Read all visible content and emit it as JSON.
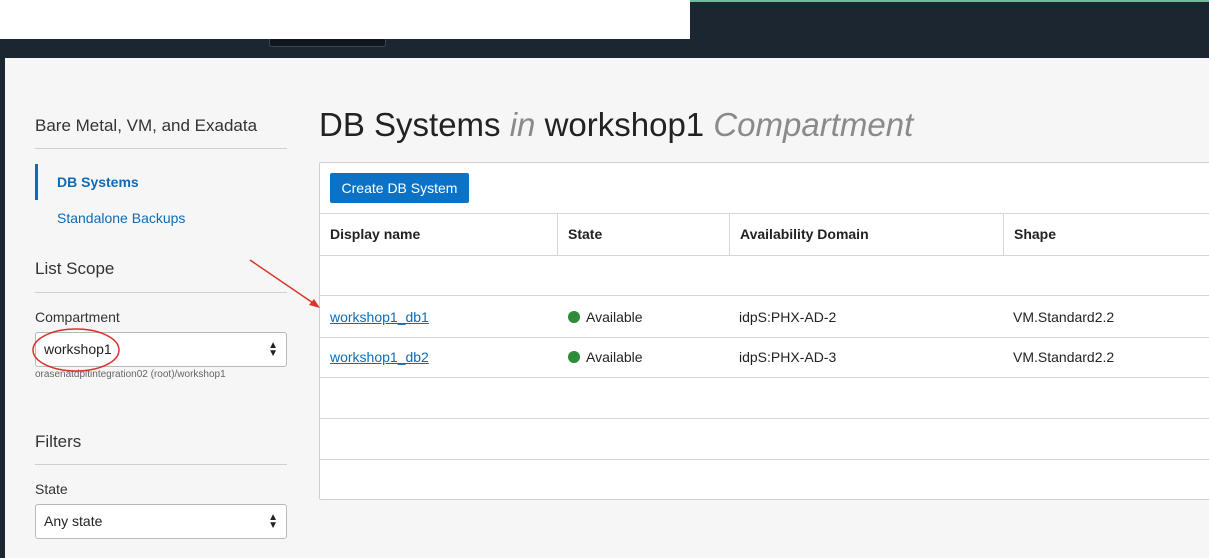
{
  "sidebar": {
    "section_title": "Bare Metal, VM, and Exadata",
    "nav_items": [
      {
        "label": "DB Systems",
        "active": true
      },
      {
        "label": "Standalone Backups",
        "active": false
      }
    ],
    "list_scope": {
      "heading": "List Scope",
      "compartment_label": "Compartment",
      "compartment_value": "workshop1",
      "compartment_path": "orasenatdpltintegration02 (root)/workshop1"
    },
    "filters": {
      "heading": "Filters",
      "state_label": "State",
      "state_value": "Any state"
    }
  },
  "main": {
    "title_part1": "DB Systems",
    "title_in": "in",
    "title_compartment": "workshop1",
    "title_suffix": "Compartment",
    "create_button_label": "Create DB System",
    "columns": [
      "Display name",
      "State",
      "Availability Domain",
      "Shape"
    ],
    "rows": [
      {
        "display_name": "workshop1_db1",
        "state": "Available",
        "availability_domain": "idpS:PHX-AD-2",
        "shape": "VM.Standard2.2"
      },
      {
        "display_name": "workshop1_db2",
        "state": "Available",
        "availability_domain": "idpS:PHX-AD-3",
        "shape": "VM.Standard2.2"
      }
    ]
  },
  "colors": {
    "link": "#0d6bb8",
    "primary_button": "#0c72c5",
    "status_available": "#2e8b3a",
    "annotation": "#d9342b",
    "header_bar": "#1c2631"
  },
  "icons": {
    "select_arrows": "up-down-chevron-icon",
    "status_dot": "status-available-icon"
  }
}
